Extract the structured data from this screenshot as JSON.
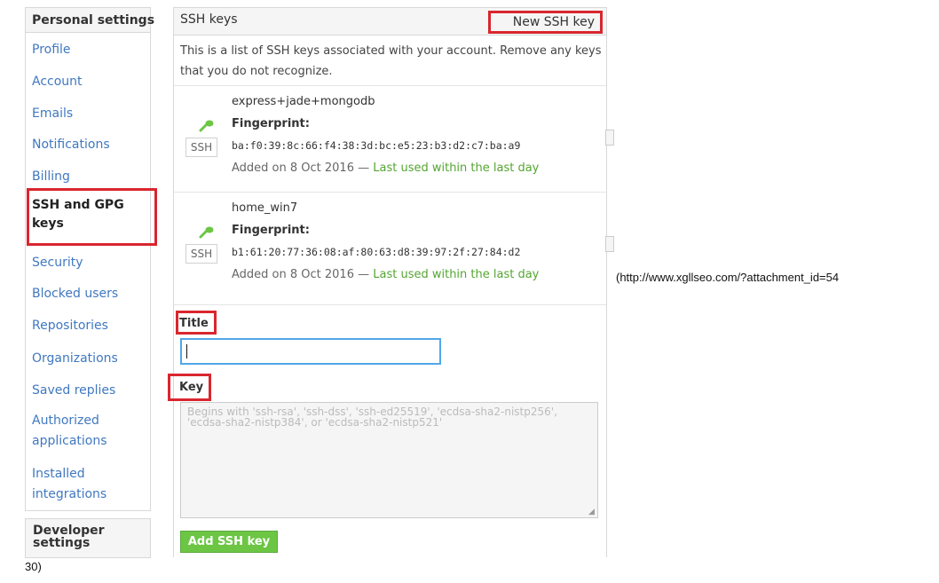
{
  "sidebar": {
    "header": "Personal settings",
    "items": [
      {
        "label": "Profile"
      },
      {
        "label": "Account"
      },
      {
        "label": "Emails"
      },
      {
        "label": "Notifications"
      },
      {
        "label": "Billing"
      },
      {
        "label": "SSH and GPG keys",
        "selected": true
      },
      {
        "label": "Security"
      },
      {
        "label": "Blocked users"
      },
      {
        "label": "Repositories"
      },
      {
        "label": "Organizations"
      },
      {
        "label": "Saved replies"
      },
      {
        "label": "Authorized applications"
      },
      {
        "label": "Installed integrations"
      }
    ],
    "developer_settings": "Developer settings"
  },
  "panel": {
    "title": "SSH keys",
    "new_key_button": "New SSH key",
    "intro": "This is a list of SSH keys associated with your account. Remove any keys that you do not recognize."
  },
  "keys": [
    {
      "name": "express+jade+mongodb",
      "fingerprint_label": "Fingerprint:",
      "fingerprint": "ba:f0:39:8c:66:f4:38:3d:bc:e5:23:b3:d2:c7:ba:a9",
      "added": "Added on 8 Oct 2016 —",
      "last_used": "Last used within the last day",
      "badge": "SSH"
    },
    {
      "name": "home_win7",
      "fingerprint_label": "Fingerprint:",
      "fingerprint": "b1:61:20:77:36:08:af:80:63:d8:39:97:2f:27:84:d2",
      "added": "Added on 8 Oct 2016 —",
      "last_used": "Last used within the last day",
      "badge": "SSH"
    }
  ],
  "form": {
    "title_label": "Title",
    "title_value": "",
    "key_label": "Key",
    "key_placeholder": "Begins with 'ssh-rsa', 'ssh-dss', 'ssh-ed25519', 'ecdsa-sha2-nistp256', 'ecdsa-sha2-nistp384', or 'ecdsa-sha2-nistp521'",
    "add_button": "Add SSH key"
  },
  "caption": {
    "line1": "(http://www.xgllseo.com/?attachment_id=54",
    "line2": "30)"
  },
  "colors": {
    "link": "#4078c0",
    "highlight_box": "#d9262f",
    "last_used": "#55a532",
    "add_button": "#6cc644",
    "key_icon": "#6cc644"
  },
  "icons": {
    "key": "key-icon",
    "resize": "resize-grip-icon"
  }
}
